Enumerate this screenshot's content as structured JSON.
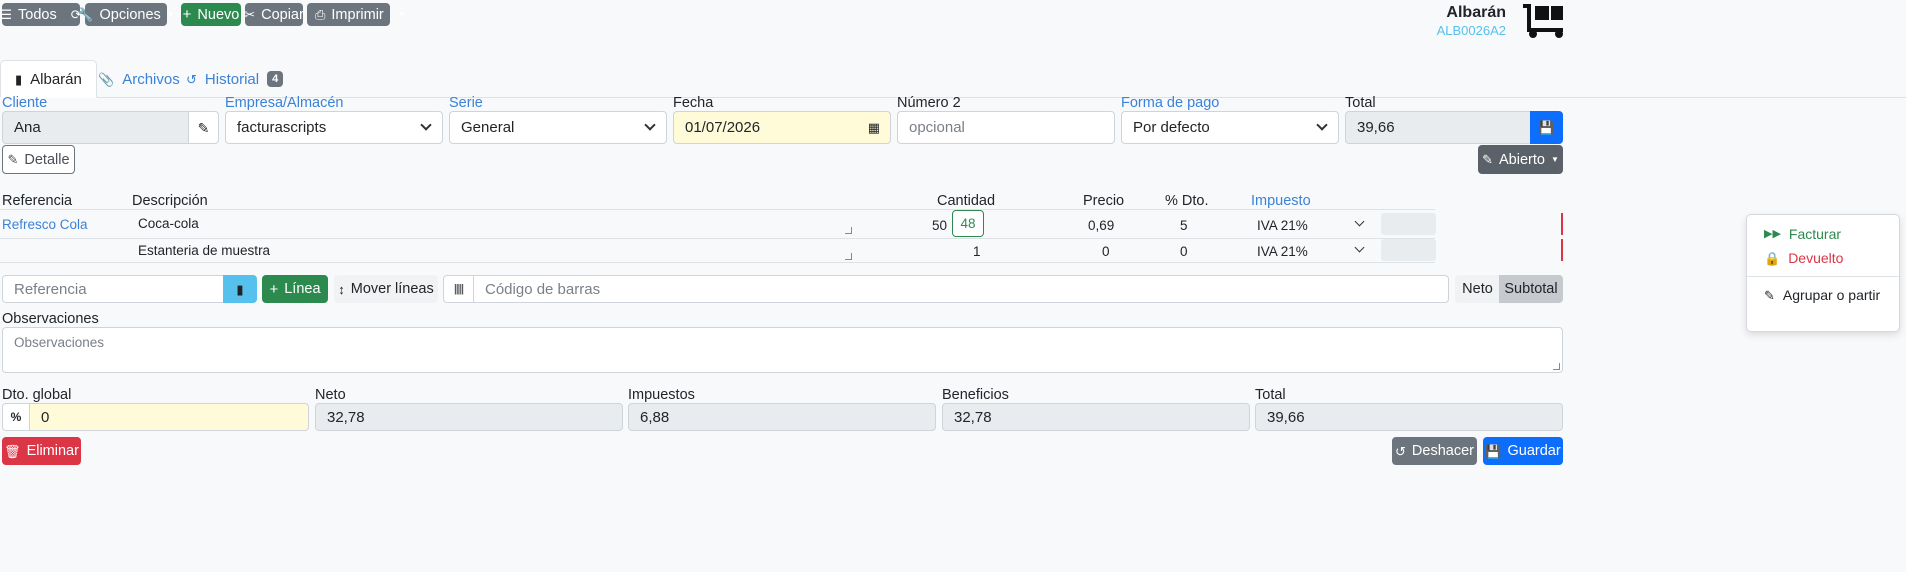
{
  "toolbar": {
    "todos": "Todos",
    "opciones": "Opciones",
    "nuevo": "Nuevo",
    "copiar": "Copiar",
    "imprimir": "Imprimir"
  },
  "header": {
    "title": "Albarán",
    "code": "ALB0026A2"
  },
  "tabs": [
    {
      "label": "Albarán"
    },
    {
      "label": "Archivos"
    },
    {
      "label": "Historial",
      "badge": "4"
    }
  ],
  "form": {
    "cliente_label": "Cliente",
    "cliente_value": "Ana",
    "empresa_label": "Empresa/Almacén",
    "empresa_value": "facturascripts",
    "serie_label": "Serie",
    "serie_value": "General",
    "fecha_label": "Fecha",
    "fecha_value": "01/07/2026",
    "numero2_label": "Número 2",
    "numero2_placeholder": "opcional",
    "pago_label": "Forma de pago",
    "pago_value": "Por defecto",
    "total_label": "Total",
    "total_value": "39,66"
  },
  "detalle_button": "Detalle",
  "estado_button": "Abierto",
  "status_menu": {
    "facturar": "Facturar",
    "devuelto": "Devuelto",
    "agrupar": "Agrupar o partir"
  },
  "lines": {
    "headers": {
      "referencia": "Referencia",
      "descripcion": "Descripción",
      "cantidad": "Cantidad",
      "precio": "Precio",
      "dto": "% Dto.",
      "impuesto": "Impuesto"
    },
    "rows": [
      {
        "referencia": "Refresco Cola",
        "descripcion": "Coca-cola",
        "cantidad": "50",
        "stock": "48",
        "precio": "0,69",
        "dto": "5",
        "impuesto": "IVA 21%"
      },
      {
        "referencia": "",
        "descripcion": "Estanteria de muestra",
        "cantidad": "1",
        "stock": "",
        "precio": "0",
        "dto": "0",
        "impuesto": "IVA 21%"
      }
    ]
  },
  "addline": {
    "referencia_placeholder": "Referencia",
    "linea_button": "Línea",
    "mover_button": "Mover líneas",
    "barcode_placeholder": "Código de barras",
    "neto_toggle": "Neto",
    "subtotal_toggle": "Subtotal"
  },
  "observaciones": {
    "label": "Observaciones",
    "placeholder": "Observaciones"
  },
  "totals": {
    "dto_label": "Dto. global",
    "dto_value": "0",
    "neto_label": "Neto",
    "neto_value": "32,78",
    "impuestos_label": "Impuestos",
    "impuestos_value": "6,88",
    "beneficios_label": "Beneficios",
    "beneficios_value": "32,78",
    "total_label": "Total",
    "total_value": "39,66"
  },
  "footer": {
    "eliminar": "Eliminar",
    "deshacer": "Deshacer",
    "guardar": "Guardar"
  },
  "icons": {
    "list": "list-icon",
    "refresh": "refresh-icon",
    "wrench": "wrench-icon",
    "plus": "plus-icon",
    "scissors": "scissors-icon",
    "print": "print-icon",
    "dolly": "dolly-icon"
  },
  "colors": {
    "primary": "#0d6efd",
    "success": "#2d8a4e",
    "danger": "#dc3545",
    "secondary": "#6c757d",
    "link": "#3b82d6",
    "info": "#56c1ec"
  }
}
